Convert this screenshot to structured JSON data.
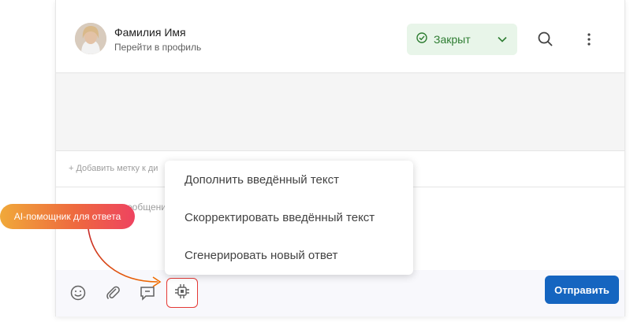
{
  "contact": {
    "name": "Фамилия Имя",
    "profile_link": "Перейти в профиль"
  },
  "status": {
    "label": "Закрыт",
    "color": "#2e7d32",
    "icon": "check-circle-icon"
  },
  "header_actions": [
    "search-icon",
    "more-vertical-icon"
  ],
  "tag": {
    "add_label": "+ Добавить метку к ди"
  },
  "compose": {
    "placeholder": "ообщени"
  },
  "toolbar": {
    "icons": [
      "emoji-icon",
      "paperclip-icon",
      "quick-reply-icon",
      "ai-assistant-icon"
    ],
    "send_label": "Отправить",
    "send_color": "#1565c0"
  },
  "ai_menu": {
    "items": [
      "Дополнить введённый текст",
      "Скорректировать введённый текст",
      "Сгенерировать новый ответ"
    ]
  },
  "callout": {
    "label": "AI-помощник для ответа",
    "colors": [
      "#f0a93a",
      "#ee4360"
    ]
  }
}
